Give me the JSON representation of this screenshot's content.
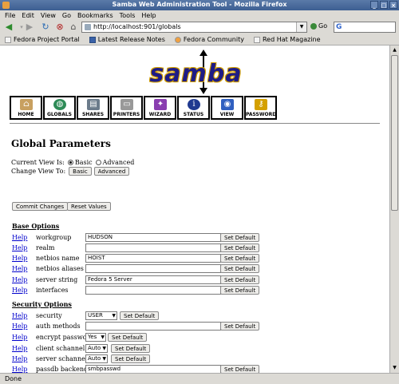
{
  "window": {
    "title": "Samba Web Administration Tool - Mozilla Firefox"
  },
  "menu": [
    "File",
    "Edit",
    "View",
    "Go",
    "Bookmarks",
    "Tools",
    "Help"
  ],
  "nav": {
    "url": "http://localhost:901/globals",
    "go_label": "Go",
    "search_placeholder": "G"
  },
  "bookmarks": [
    "Fedora Project Portal",
    "Latest Release Notes",
    "Fedora Community",
    "Red Hat Magazine"
  ],
  "logo": {
    "text": "samba"
  },
  "toolbar": [
    {
      "label": "HOME",
      "icon": "house-icon",
      "color": "#c8a060"
    },
    {
      "label": "GLOBALS",
      "icon": "globe-icon",
      "color": "#2e8b57"
    },
    {
      "label": "SHARES",
      "icon": "shares-icon",
      "color": "#6b7b8b"
    },
    {
      "label": "PRINTERS",
      "icon": "printer-icon",
      "color": "#777777"
    },
    {
      "label": "WIZARD",
      "icon": "wizard-icon",
      "color": "#8a3fb0"
    },
    {
      "label": "STATUS",
      "icon": "status-icon",
      "color": "#203a90"
    },
    {
      "label": "VIEW",
      "icon": "view-icon",
      "color": "#3060c0"
    },
    {
      "label": "PASSWORD",
      "icon": "key-icon",
      "color": "#d4a000"
    }
  ],
  "page": {
    "heading": "Global Parameters",
    "current_view_label": "Current View Is:",
    "view_basic": "Basic",
    "view_advanced": "Advanced",
    "change_view_label": "Change View To:",
    "btn_basic": "Basic",
    "btn_advanced": "Advanced",
    "commit": "Commit Changes",
    "reset": "Reset Values",
    "help": "Help",
    "set_default": "Set Default"
  },
  "base_options": {
    "title": "Base Options",
    "params": [
      {
        "name": "workgroup",
        "value": "HUDSON"
      },
      {
        "name": "realm",
        "value": ""
      },
      {
        "name": "netbios name",
        "value": "HOIST"
      },
      {
        "name": "netbios aliases",
        "value": ""
      },
      {
        "name": "server string",
        "value": "Fedora 5 Server"
      },
      {
        "name": "interfaces",
        "value": ""
      }
    ]
  },
  "security_options": {
    "title": "Security Options",
    "security": {
      "name": "security",
      "value": "USER"
    },
    "auth_methods": {
      "name": "auth methods",
      "value": ""
    },
    "encrypt_passwords": {
      "name": "encrypt passwords",
      "value": "Yes"
    },
    "client_schannel": {
      "name": "client schannel",
      "value": "Auto"
    },
    "server_schannel": {
      "name": "server schannel",
      "value": "Auto"
    },
    "passdb_backend": {
      "name": "passdb backend",
      "value": "smbpasswd"
    }
  },
  "status": "Done"
}
